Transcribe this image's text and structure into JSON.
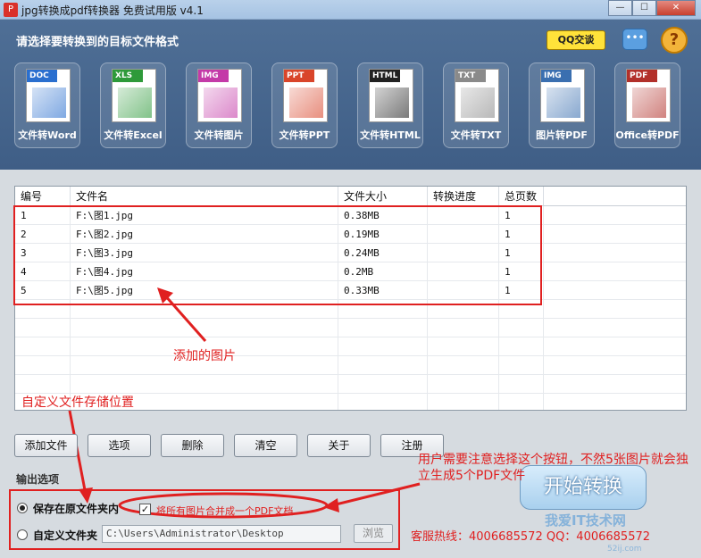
{
  "window": {
    "title": "jpg转换成pdf转换器 免费试用版 v4.1",
    "app_icon": "pdf-app-icon",
    "min": "—",
    "max": "☐",
    "close": "✕"
  },
  "header": {
    "title": "请选择要转换到的目标文件格式",
    "qq_label": "QQ交谈",
    "chat_icon": "chat-bubble-icon",
    "help_icon": "?",
    "tools": [
      {
        "tag": "DOC",
        "label": "文件转Word",
        "color": "#2a6fcf"
      },
      {
        "tag": "XLS",
        "label": "文件转Excel",
        "color": "#2e9a3a"
      },
      {
        "tag": "IMG",
        "label": "文件转图片",
        "color": "#c43aa8"
      },
      {
        "tag": "PPT",
        "label": "文件转PPT",
        "color": "#d9452a"
      },
      {
        "tag": "HTML",
        "label": "文件转HTML",
        "color": "#222222"
      },
      {
        "tag": "TXT",
        "label": "文件转TXT",
        "color": "#8a8a8a"
      },
      {
        "tag": "IMG",
        "label": "图片转PDF",
        "color": "#3a6fb0"
      },
      {
        "tag": "PDF",
        "label": "Office转PDF",
        "color": "#b2302a"
      }
    ]
  },
  "table": {
    "headers": [
      "编号",
      "文件名",
      "文件大小",
      "转换进度",
      "总页数"
    ],
    "rows": [
      {
        "id": "1",
        "name": "F:\\图1.jpg",
        "size": "0.38MB",
        "progress": "",
        "pages": "1"
      },
      {
        "id": "2",
        "name": "F:\\图2.jpg",
        "size": "0.19MB",
        "progress": "",
        "pages": "1"
      },
      {
        "id": "3",
        "name": "F:\\图3.jpg",
        "size": "0.24MB",
        "progress": "",
        "pages": "1"
      },
      {
        "id": "4",
        "name": "F:\\图4.jpg",
        "size": "0.2MB",
        "progress": "",
        "pages": "1"
      },
      {
        "id": "5",
        "name": "F:\\图5.jpg",
        "size": "0.33MB",
        "progress": "",
        "pages": "1"
      }
    ]
  },
  "annotations": {
    "added_images": "添加的图片",
    "custom_location": "自定义文件存储位置",
    "note": "用户需要注意选择这个按钮，不然5张图片就会独立生成5个PDF文件"
  },
  "buttons": {
    "add_file": "添加文件",
    "options": "选项",
    "delete": "删除",
    "clear": "清空",
    "about": "关于",
    "register": "注册"
  },
  "output": {
    "section_label": "输出选项",
    "save_original": "保存在原文件夹内",
    "custom_folder": "自定义文件夹",
    "merge_label": "将所有图片合并成一个PDF文档",
    "merge_checked": true,
    "path_value": "C:\\Users\\Administrator\\Desktop",
    "browse": "浏览",
    "start": "开始转换",
    "hotline": "客服热线：4006685572 QQ：4006685572"
  },
  "watermark": {
    "text": "我爱IT技术网",
    "url": "52ij.com"
  }
}
